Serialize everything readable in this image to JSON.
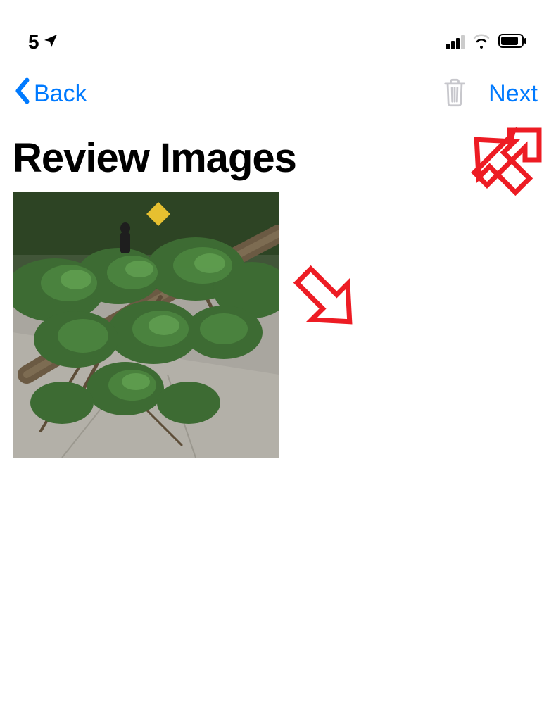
{
  "status_bar": {
    "partial_text": "5",
    "icons": {
      "location": "location-arrow-icon",
      "cellular": "cellular-signal-icon",
      "wifi": "wifi-icon",
      "battery": "battery-icon"
    }
  },
  "nav": {
    "back_label": "Back",
    "next_label": "Next",
    "trash_icon": "trash-icon"
  },
  "page": {
    "title": "Review Images"
  },
  "thumbnails": [
    {
      "alt": "Fallen tree branches on a concrete walkway in a wooded area",
      "selected": false
    }
  ],
  "annotations": [
    {
      "type": "arrow",
      "target": "next-button",
      "direction": "up-right"
    },
    {
      "type": "arrow",
      "target": "thumbnail",
      "direction": "down-left"
    }
  ],
  "colors": {
    "tint": "#007aff",
    "disabled_icon": "#c7c7cc",
    "annotation": "#ed1c24"
  }
}
